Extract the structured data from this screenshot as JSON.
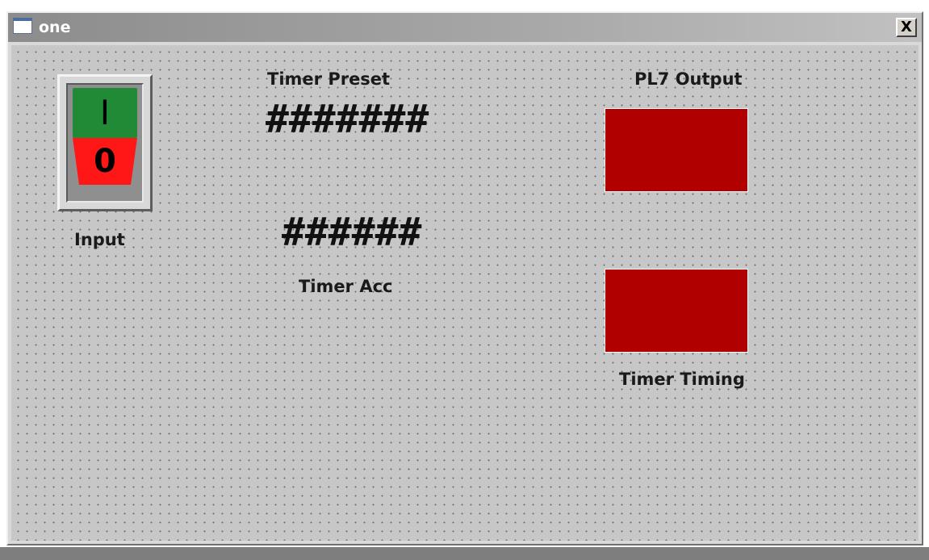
{
  "window": {
    "title": "one",
    "close_label": "X"
  },
  "controls": {
    "input_switch": {
      "on_label": "I",
      "off_label": "0",
      "label": "Input",
      "on_color": "#218a37",
      "off_color": "#ff1616"
    },
    "timer_preset": {
      "label": "Timer Preset",
      "value": "#######"
    },
    "timer_acc": {
      "label": "Timer Acc",
      "value": "######"
    },
    "pl7_output": {
      "label": "PL7 Output",
      "color": "#b00000"
    },
    "timer_timing": {
      "label": "Timer Timing",
      "color": "#b00000"
    }
  }
}
